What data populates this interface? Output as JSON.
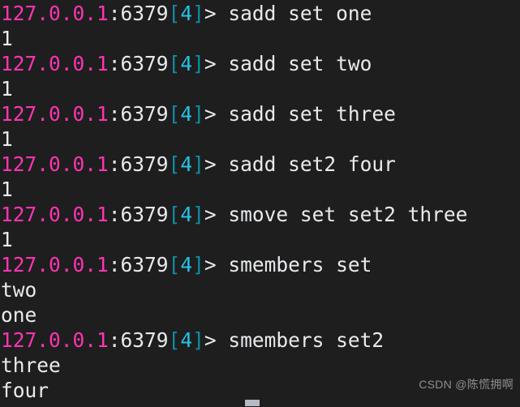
{
  "terminal": {
    "background_color": "#1e1e1e",
    "prompt": {
      "host": "127.0.0.1",
      "sep": ":",
      "port": "6379",
      "bracket_open": "[",
      "db_index": "4",
      "bracket_close": "]",
      "arrow": "> ",
      "colors": {
        "host": "#ff34b3",
        "port": "#e8eaed",
        "bracket": "#0e8fa8",
        "db_index": "#24c3e8",
        "text": "#e8eaed"
      }
    },
    "lines": [
      {
        "type": "prompt",
        "command": "sadd set one"
      },
      {
        "type": "output",
        "text": "1"
      },
      {
        "type": "prompt",
        "command": "sadd set two"
      },
      {
        "type": "output",
        "text": "1"
      },
      {
        "type": "prompt",
        "command": "sadd set three"
      },
      {
        "type": "output",
        "text": "1"
      },
      {
        "type": "prompt",
        "command": "sadd set2 four"
      },
      {
        "type": "output",
        "text": "1"
      },
      {
        "type": "prompt",
        "command": "smove set set2 three"
      },
      {
        "type": "output",
        "text": "1"
      },
      {
        "type": "prompt",
        "command": "smembers set"
      },
      {
        "type": "output",
        "text": "two"
      },
      {
        "type": "output",
        "text": "one"
      },
      {
        "type": "prompt",
        "command": "smembers set2"
      },
      {
        "type": "output",
        "text": "three"
      },
      {
        "type": "output",
        "text": "four"
      }
    ],
    "cursor": {
      "visible": true,
      "color": "#b6bac4"
    },
    "watermark": "CSDN @陈慌拥啊"
  }
}
